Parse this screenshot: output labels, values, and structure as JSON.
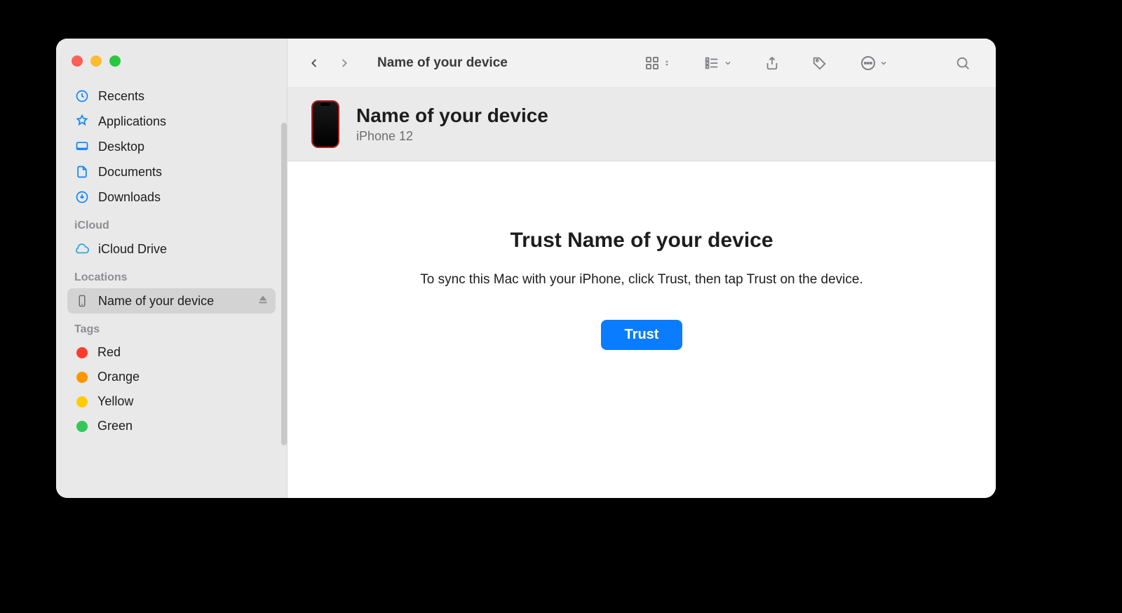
{
  "window_title": "Name of your device",
  "sidebar": {
    "favorites": [
      {
        "icon": "clock",
        "label": "Recents"
      },
      {
        "icon": "appstore",
        "label": "Applications"
      },
      {
        "icon": "desktop",
        "label": "Desktop"
      },
      {
        "icon": "document",
        "label": "Documents"
      },
      {
        "icon": "download",
        "label": "Downloads"
      }
    ],
    "sections": {
      "icloud": {
        "header": "iCloud",
        "items": [
          {
            "icon": "cloud",
            "label": "iCloud Drive"
          }
        ]
      },
      "locations": {
        "header": "Locations",
        "items": [
          {
            "icon": "iphone",
            "label": "Name of your device",
            "selected": true,
            "ejectable": true
          }
        ]
      },
      "tags": {
        "header": "Tags",
        "items": [
          {
            "color": "#ff3b30",
            "label": "Red"
          },
          {
            "color": "#ff9500",
            "label": "Orange"
          },
          {
            "color": "#ffcc00",
            "label": "Yellow"
          },
          {
            "color": "#34c759",
            "label": "Green"
          }
        ]
      }
    }
  },
  "device": {
    "name": "Name of your device",
    "model": "iPhone 12"
  },
  "trust_panel": {
    "title": "Trust Name of your device",
    "description": "To sync this Mac with your iPhone, click Trust, then tap Trust on the device.",
    "button_label": "Trust"
  },
  "toolbar_icons": [
    "grid-view",
    "group-by",
    "share",
    "tags",
    "more",
    "search"
  ],
  "colors": {
    "accent": "#0a7cff"
  }
}
